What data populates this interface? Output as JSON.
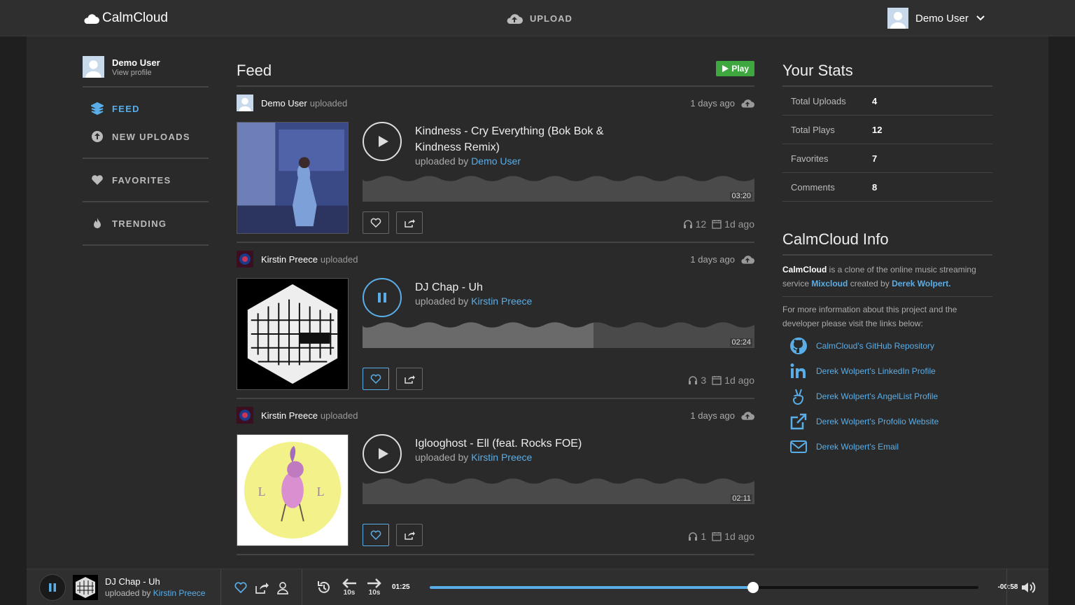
{
  "topbar": {
    "logo": "CalmCloud",
    "upload": "UPLOAD",
    "user": "Demo User"
  },
  "sidebar": {
    "profile_name": "Demo User",
    "profile_sub": "View profile",
    "nav": [
      "FEED",
      "NEW UPLOADS",
      "FAVORITES",
      "TRENDING"
    ]
  },
  "feed": {
    "title": "Feed",
    "play_all": "Play",
    "posts": [
      {
        "user": "Demo User",
        "action": "uploaded",
        "when": "1 days ago",
        "title": "Kindness - Cry Everything (Bok Bok & Kindness Remix)",
        "by_prefix": "uploaded by",
        "by": "Demo User",
        "duration": "03:20",
        "progress": 0,
        "plays": "12",
        "date": "1d ago",
        "state": "paused",
        "favorited": false
      },
      {
        "user": "Kirstin Preece",
        "action": "uploaded",
        "when": "1 days ago",
        "title": "DJ Chap - Uh",
        "by_prefix": "uploaded by",
        "by": "Kirstin Preece",
        "duration": "02:24",
        "progress": 0.59,
        "plays": "3",
        "date": "1d ago",
        "state": "playing",
        "favorited": true
      },
      {
        "user": "Kirstin Preece",
        "action": "uploaded",
        "when": "1 days ago",
        "title": "Iglooghost - Ell (feat. Rocks FOE)",
        "by_prefix": "uploaded by",
        "by": "Kirstin Preece",
        "duration": "02:11",
        "progress": 0,
        "plays": "1",
        "date": "1d ago",
        "state": "paused",
        "favorited": true
      }
    ]
  },
  "stats": {
    "title": "Your Stats",
    "rows": [
      {
        "k": "Total Uploads",
        "v": "4"
      },
      {
        "k": "Total Plays",
        "v": "12"
      },
      {
        "k": "Favorites",
        "v": "7"
      },
      {
        "k": "Comments",
        "v": "8"
      }
    ]
  },
  "info": {
    "title": "CalmCloud Info",
    "p1_brand": "CalmCloud",
    "p1_mid": " is a clone of the online music streaming service ",
    "p1_link": "Mixcloud",
    "p1_mid2": " created by ",
    "p1_author": "Derek Wolpert.",
    "p2": "For more information about this project and the developer please visit the links below:",
    "links": [
      {
        "icon": "github-icon",
        "label": "CalmCloud's GitHub Repository"
      },
      {
        "icon": "linkedin-icon",
        "label": "Derek Wolpert's LinkedIn Profile"
      },
      {
        "icon": "angellist-icon",
        "label": "Derek Wolpert's AngelList Profile"
      },
      {
        "icon": "external-link-icon",
        "label": "Derek Wolpert's Profolio Website"
      },
      {
        "icon": "email-icon",
        "label": "Derek Wolpert's Email"
      }
    ]
  },
  "player": {
    "title": "DJ Chap - Uh",
    "by_prefix": "uploaded by",
    "by": "Kirstin Preece",
    "elapsed": "01:25",
    "remaining": "-00:58",
    "skip_back": "10s",
    "skip_fwd": "10s",
    "progress": 0.59
  },
  "colors": {
    "accent": "#5aaee8",
    "play_green": "#3fa73f",
    "bg": "#2a2a2a"
  }
}
